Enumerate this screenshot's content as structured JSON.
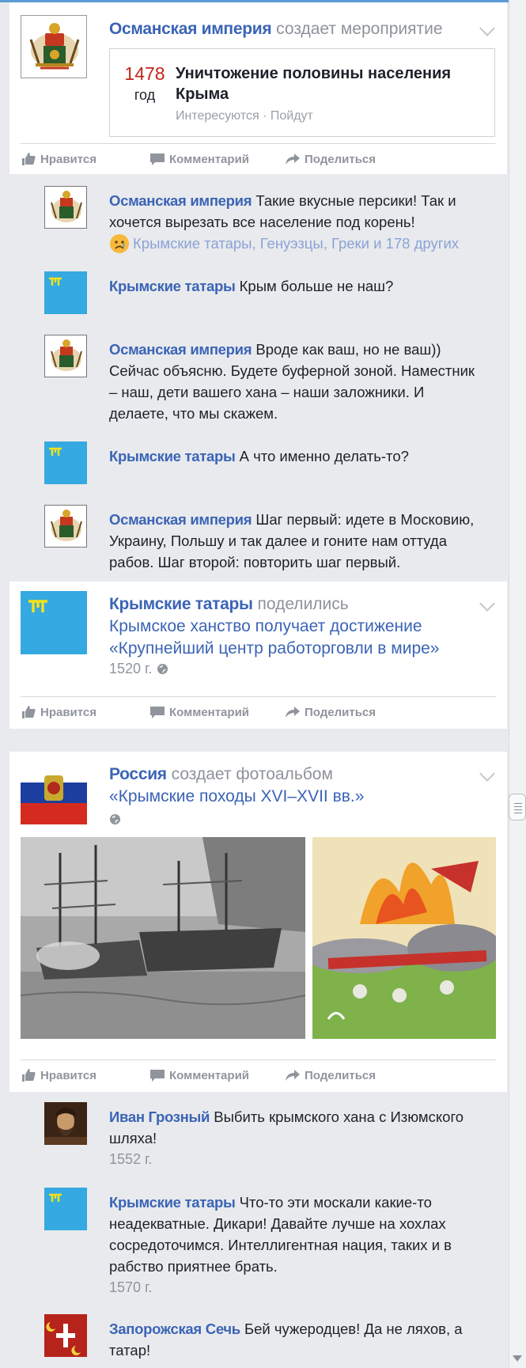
{
  "posts": {
    "ottoman_event": {
      "author": "Османская империя",
      "verb": "создает мероприятие",
      "event": {
        "number": "1478",
        "unit": "год",
        "title": "Уничтожение половины населения Крыма",
        "meta": "Интересуются · Пойдут"
      }
    },
    "tatars_share": {
      "author": "Крымские татары",
      "verb": "поделились",
      "text": "Крымское ханство получает достижение «Крупнейший центр работорговли в мире»",
      "date": "1520 г."
    },
    "russia_album": {
      "author": "Россия",
      "verb": "создает фотоальбом",
      "album_title": "«Крымские походы XVI–XVII вв.»"
    }
  },
  "actions": {
    "like": "Нравится",
    "comment": "Комментарий",
    "share": "Поделиться"
  },
  "comments_1": [
    {
      "author": "Османская империя",
      "text": "Такие вкусные персики! Так и хочется вырезать все население под корень!",
      "reactions": "Крымские татары, Генуэзцы, Греки и 178 других"
    },
    {
      "author": "Крымские татары",
      "text": "Крым больше не наш?"
    },
    {
      "author": "Османская империя",
      "text": "Вроде как ваш, но не ваш)) Сейчас объясню. Будете буферной зоной. Наместник – наш, дети вашего хана – наши заложники. И делаете, что мы скажем."
    },
    {
      "author": "Крымские татары",
      "text": "А что именно делать-то?"
    },
    {
      "author": "Османская империя",
      "text": "Шаг первый: идете в Московию, Украину, Польшу и так далее и гоните нам оттуда рабов. Шаг второй: повторить шаг первый."
    }
  ],
  "comments_2": [
    {
      "author": "Иван Грозный",
      "text": "Выбить крымского хана с Изюмского шляха!",
      "date": "1552 г."
    },
    {
      "author": "Крымские татары",
      "text": "Что-то эти москали какие-то неадекватные. Дикари! Давайте лучше на хохлах сосредоточимся. Интеллигентная нация, таких и в рабство приятнее брать.",
      "date": "1570 г."
    },
    {
      "author": "Запорожская Сечь",
      "text": "Бей чужеродцев! Да не ляхов, а татар!"
    }
  ],
  "colors": {
    "author": "#3b64b6",
    "event_number": "#c0271b",
    "tatar_flag": "#35a9e1",
    "tatar_tamga": "#f2e21a"
  }
}
